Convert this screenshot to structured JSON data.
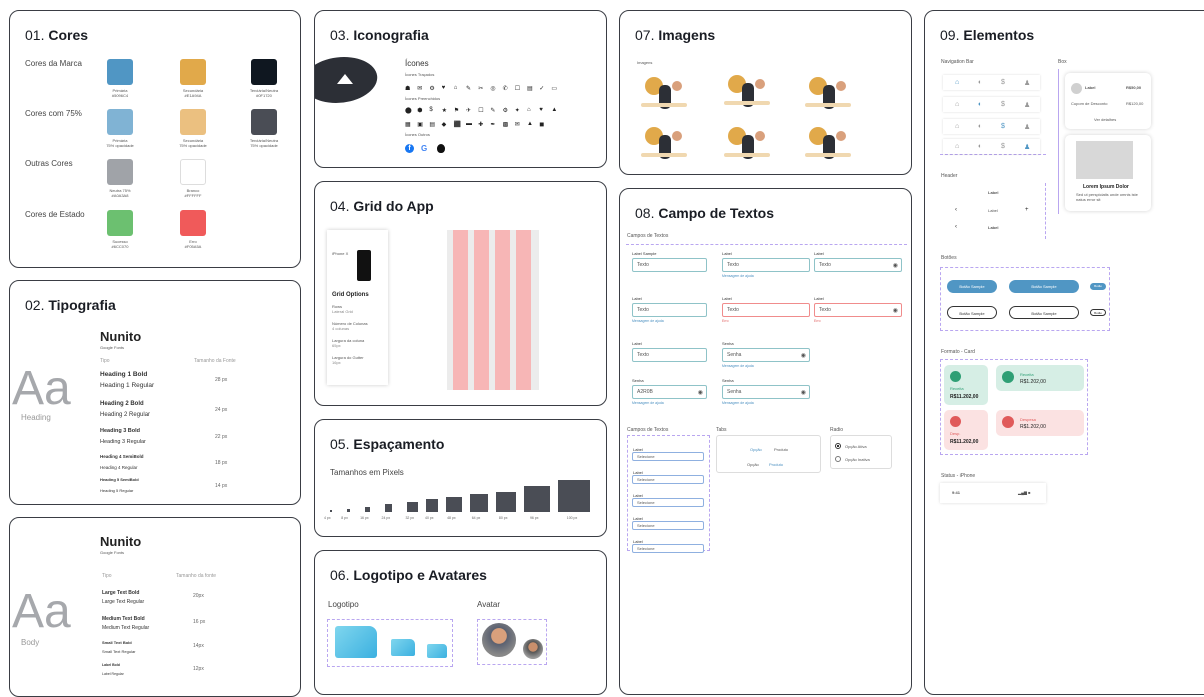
{
  "colors": {
    "title_num": "01.",
    "title_txt": "Cores",
    "row_brand": "Cores da Marca",
    "row_75": "Cores com 75%",
    "row_other": "Outras Cores",
    "row_state": "Cores de Estado",
    "swatches": [
      {
        "hex": "#5096c4",
        "name": "Primária",
        "code": "#5096C4"
      },
      {
        "hex": "#e1a94a",
        "name": "Secundária",
        "code": "#E1A94A"
      },
      {
        "hex": "#0f1720",
        "name": "Terciária/Neutra",
        "code": "#0F1720"
      },
      {
        "hex": "#80b3d4",
        "name": "Primária",
        "code": "75% opacidade"
      },
      {
        "hex": "#ebc080",
        "name": "Secundária",
        "code": "75% opacidade"
      },
      {
        "hex": "#4a4d55",
        "name": "Terciária/Neutra",
        "code": "75% opacidade"
      },
      {
        "hex": "#a0a3a8",
        "name": "Neutra 75%",
        "code": "#A0A3A8"
      },
      {
        "hex": "#ffffff",
        "name": "Branco",
        "code": "#FFFFFF"
      },
      {
        "hex": "#6cc070",
        "name": "Sucesso",
        "code": "#6CC070"
      },
      {
        "hex": "#f05a5a",
        "name": "Erro",
        "code": "#F05A5A"
      }
    ]
  },
  "typo": {
    "title_num": "02.",
    "title_txt": "Tipografia",
    "font": "Nunito",
    "sub": "Google Fonts",
    "col_type": "Tipo",
    "col_size": "Tamanho da Fonte",
    "big": "Aa",
    "big_label": "Heading",
    "rows": [
      {
        "a": "Heading 1 Bold",
        "b": "Heading 1 Regular",
        "s": "28 px"
      },
      {
        "a": "Heading 2 Bold",
        "b": "Heading 2 Regular",
        "s": "24 px"
      },
      {
        "a": "Heading 3 Bold",
        "b": "Heading 3 Regular",
        "s": "22 px"
      },
      {
        "a": "Heading 4 SemiBold",
        "b": "Heading 4 Regular",
        "s": "18 px"
      },
      {
        "a": "Heading 5 SemiBold",
        "b": "Heading 5 Regular",
        "s": "14 px"
      }
    ]
  },
  "body": {
    "font": "Nunito",
    "sub": "Google Fonts",
    "col_type": "Tipo",
    "col_size": "Tamanho da fonte",
    "big": "Aa",
    "big_label": "Body",
    "rows": [
      {
        "a": "Large Text Bold",
        "b": "Large Text Regular",
        "s": "20px"
      },
      {
        "a": "Medium Text Bold",
        "b": "Medium Text Regular",
        "s": "16 px"
      },
      {
        "a": "Small Text Bold",
        "b": "Small Text Regular",
        "s": "14px"
      },
      {
        "a": "Label Bold",
        "b": "Label Regular",
        "s": "12px"
      }
    ]
  },
  "icons": {
    "title_num": "03.",
    "title_txt": "Iconografia",
    "head": "Ícones",
    "filled": "Ícones Preenchidos",
    "lines": "Ícones Traçados",
    "others": "Ícones Outros",
    "row1": [
      "☗",
      "✉",
      "⚙",
      "♥",
      "⌂",
      "✎",
      "✂",
      "◎",
      "✆",
      "☐",
      "▤",
      "✓",
      "▭"
    ],
    "row2": [
      "⬤",
      "⬢",
      "$",
      "★",
      "⚑",
      "✈",
      "☐",
      "✎",
      "⚙",
      "✦",
      "⌂",
      "♥",
      "▲"
    ],
    "row3": [
      "▦",
      "▣",
      "▤",
      "◆",
      "⬛",
      "▬",
      "✚",
      "✒",
      "▩",
      "✉",
      "▲",
      "◼"
    ],
    "brands": [
      "f",
      "G",
      ""
    ]
  },
  "grid": {
    "title_num": "04.",
    "title_txt": "Grid do App",
    "phone_label": "iPhone X",
    "opts": "Grid Options",
    "items": [
      {
        "k": "Rows",
        "v": "Lateral Grid"
      },
      {
        "k": "Número de Colunas",
        "v": "4 colunas"
      },
      {
        "k": "Largura da coluna",
        "v": "65px"
      },
      {
        "k": "Largura do Gutter",
        "v": "16px"
      }
    ]
  },
  "spacing": {
    "title_num": "05.",
    "title_txt": "Espaçamento",
    "sub": "Tamanhos em Pixels",
    "values": [
      4,
      8,
      16,
      24,
      32,
      40,
      48,
      56,
      64,
      80,
      100
    ],
    "labels": [
      "4 px",
      "8 px",
      "16 px",
      "24 px",
      "32 px",
      "40 px",
      "48 px",
      "64 px",
      "80 px",
      "96 px",
      "100 px"
    ]
  },
  "logo": {
    "title_num": "06.",
    "title_txt": "Logotipo e Avatares",
    "logo_label": "Logotipo",
    "avatar_label": "Avatar"
  },
  "images": {
    "title_num": "07.",
    "title_txt": "Imagens",
    "sub": "Imagens"
  },
  "fields": {
    "title_num": "08.",
    "title_txt": "Campo de Textos",
    "section": "Campos de Textos",
    "label": "Label",
    "label_sample": "Label Sample",
    "text": "Texto",
    "pw": "Senha",
    "note": "Mensagem de ajuda",
    "note_err": "Erro",
    "acc": "A2R0B",
    "sec2": "Campos de Textos",
    "tabs": "Tabs",
    "radio": "Radio",
    "tab_a": "Opção",
    "tab_b": "Produto",
    "radio_a": "Opção Ativa",
    "radio_b": "Opção Inativa",
    "sel": "Selecione"
  },
  "elements": {
    "title_num": "09.",
    "title_txt": "Elementos",
    "nav": "Navigation Bar",
    "box": "Box",
    "header": "Header",
    "buttons": "Botões",
    "cards": "Formato - Card",
    "status": "Status - iPhone",
    "box_label": "Label",
    "box_price": "R$50,00",
    "box_price2": "R$120,00",
    "box_desc": "Cupom de Desconto",
    "box_link": "Ver detalhes",
    "lorem": "Lorem Ipsum Dolor",
    "lorem_sub": "Sed ut perspiciatis unde omnis iste natus error sit",
    "hdr_label": "Label",
    "hdr_label2": "Label",
    "hdr_label3": "Label",
    "btn": "Botão Sample",
    "btn_small": "Botão",
    "time": "9:41",
    "signal": "▂▄▆ ■",
    "c1_title": "Receita",
    "c1_val": "R$11.202,00",
    "c2_title": "Receita",
    "c2_val": "R$1.202,00",
    "c3_title": "Desp.",
    "c3_val": "R$11.202,00",
    "c4_title": "Despesa",
    "c4_val": "R$1.202,00"
  }
}
